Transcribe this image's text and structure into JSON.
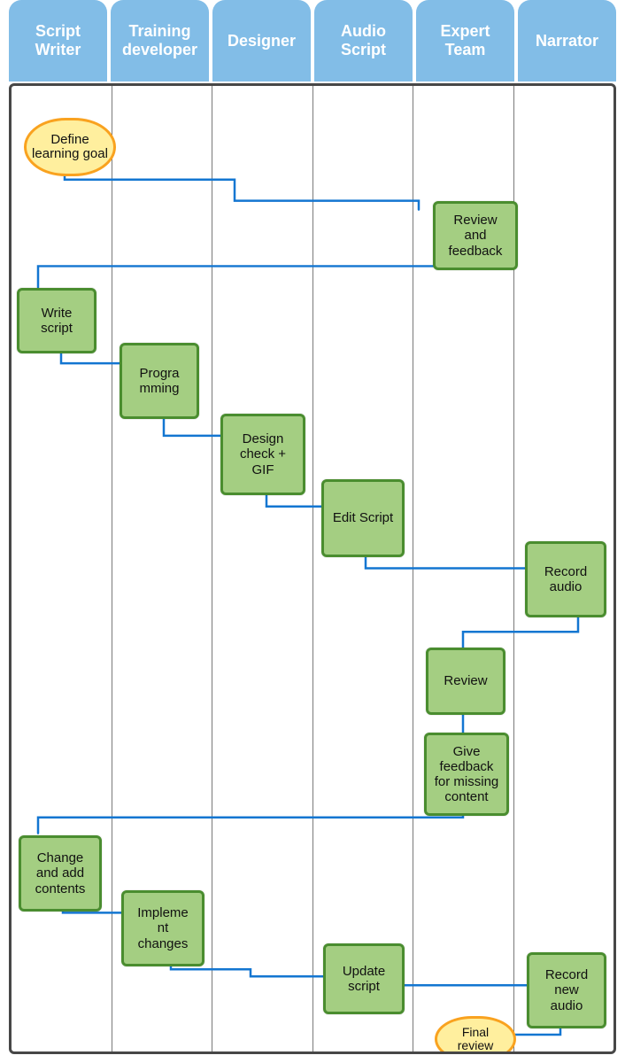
{
  "lanes": [
    {
      "title": "Script Writer"
    },
    {
      "title": "Training developer"
    },
    {
      "title": "Designer"
    },
    {
      "title": "Audio Script"
    },
    {
      "title": "Expert Team"
    },
    {
      "title": "Narrator"
    }
  ],
  "nodes": {
    "define_goal": {
      "label": "Define learning goal"
    },
    "review_feedback": {
      "label": "Review and feedback"
    },
    "write_script": {
      "label": "Write script"
    },
    "programming": {
      "label": "Progra mming"
    },
    "design_check": {
      "label": "Design check + GIF"
    },
    "edit_script": {
      "label": "Edit Script"
    },
    "record_audio": {
      "label": "Record audio"
    },
    "review": {
      "label": "Review"
    },
    "give_feedback": {
      "label": "Give feedback for missing content"
    },
    "change_add": {
      "label": "Change and add contents"
    },
    "implement": {
      "label": "Impleme nt changes"
    },
    "update_script": {
      "label": "Update script"
    },
    "record_new": {
      "label": "Record new audio"
    },
    "final_review": {
      "label": "Final review"
    }
  },
  "colors": {
    "lane_head_bg": "#82bde7",
    "lane_head_text": "#ffffff",
    "connector": "#1376d1",
    "task_bg": "#a4ce82",
    "task_border": "#4a8d2f",
    "event_bg": "#ffef9e",
    "event_border": "#f9a21f",
    "frame_border": "#474747",
    "lane_divider": "#7a7a7a"
  }
}
